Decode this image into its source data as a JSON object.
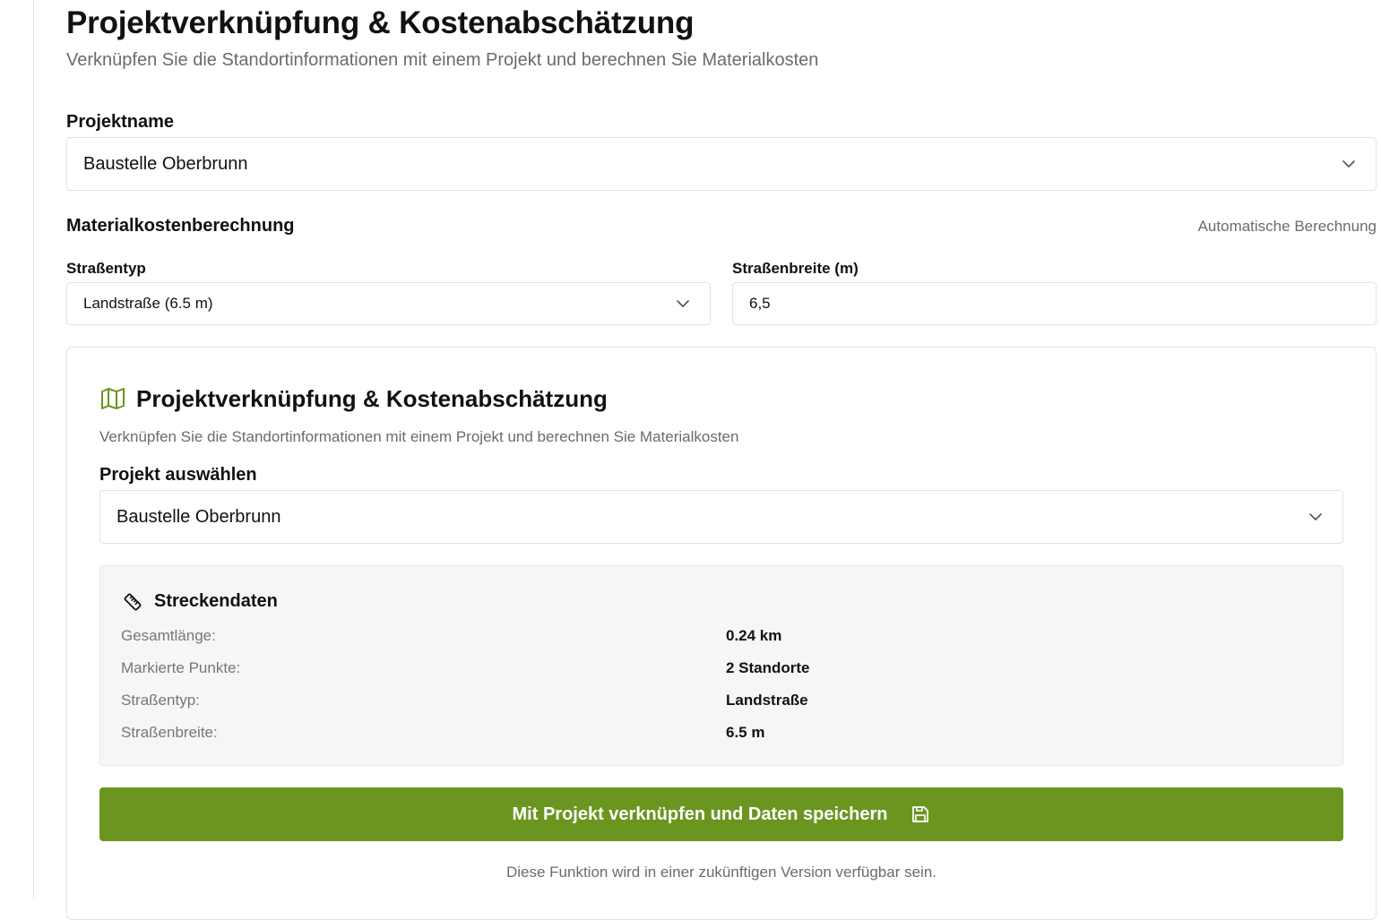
{
  "header": {
    "title": "Projektverknüpfung & Kostenabschätzung",
    "subtitle": "Verknüpfen Sie die Standortinformationen mit einem Projekt und berechnen Sie Materialkosten"
  },
  "project_name": {
    "label": "Projektname",
    "selected": "Baustelle Oberbrunn"
  },
  "material_costs": {
    "title": "Materialkostenberechnung",
    "mode": "Automatische Berechnung",
    "road_type": {
      "label": "Straßentyp",
      "selected": "Landstraße (6.5 m)"
    },
    "road_width": {
      "label": "Straßenbreite (m)",
      "value": "6,5"
    }
  },
  "card": {
    "title": "Projektverknüpfung & Kostenabschätzung",
    "subtitle": "Verknüpfen Sie die Standortinformationen mit einem Projekt und berechnen Sie Materialkosten",
    "project_select": {
      "label": "Projekt auswählen",
      "selected": "Baustelle Oberbrunn"
    },
    "route_data": {
      "title": "Streckendaten",
      "rows": [
        {
          "label": "Gesamtlänge:",
          "value": "0.24 km"
        },
        {
          "label": "Markierte Punkte:",
          "value": "2 Standorte"
        },
        {
          "label": "Straßentyp:",
          "value": "Landstraße"
        },
        {
          "label": "Straßenbreite:",
          "value": "6.5 m"
        }
      ]
    },
    "save_button": "Mit Projekt verknüpfen und Daten speichern",
    "footnote": "Diese Funktion wird in einer zukünftigen Version verfügbar sein."
  },
  "colors": {
    "accent": "#6a961f",
    "muted_text": "#6b6b6b",
    "border": "#e2e2e2",
    "panel_bg": "#f6f6f4"
  },
  "icons": {
    "card_icon": "map-icon",
    "route_icon": "ruler-icon",
    "button_icon": "save-icon",
    "select_icon": "chevron-down-icon"
  }
}
